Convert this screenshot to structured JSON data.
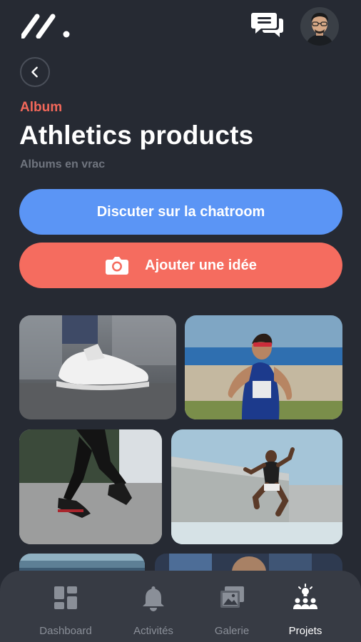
{
  "header": {
    "logo_icon": "brand-slash-logo",
    "chat_icon": "chat-bubbles-icon",
    "avatar": "user-avatar"
  },
  "back_icon": "chevron-left-icon",
  "album": {
    "section_label": "Album",
    "title": "Athletics products",
    "subtitle": "Albums en vrac"
  },
  "actions": {
    "chat_button": "Discuter sur la chatroom",
    "idea_button": "Ajouter une idée",
    "idea_icon": "camera-icon"
  },
  "gallery": {
    "photos": [
      "sneakers-photo",
      "runner-woman-photo",
      "running-legs-photo",
      "jumping-athlete-photo",
      "track-photo",
      "sports-crowd-photo"
    ]
  },
  "bottom_nav": {
    "items": [
      {
        "label": "Dashboard",
        "icon": "dashboard-grid-icon"
      },
      {
        "label": "Activités",
        "icon": "bell-icon"
      },
      {
        "label": "Galerie",
        "icon": "image-gallery-icon"
      },
      {
        "label": "Projets",
        "icon": "team-idea-icon",
        "active": true
      }
    ]
  },
  "colors": {
    "background": "#262a33",
    "accent_red": "#f56c5f",
    "accent_blue": "#5b95f5",
    "nav_background": "#373b44"
  }
}
